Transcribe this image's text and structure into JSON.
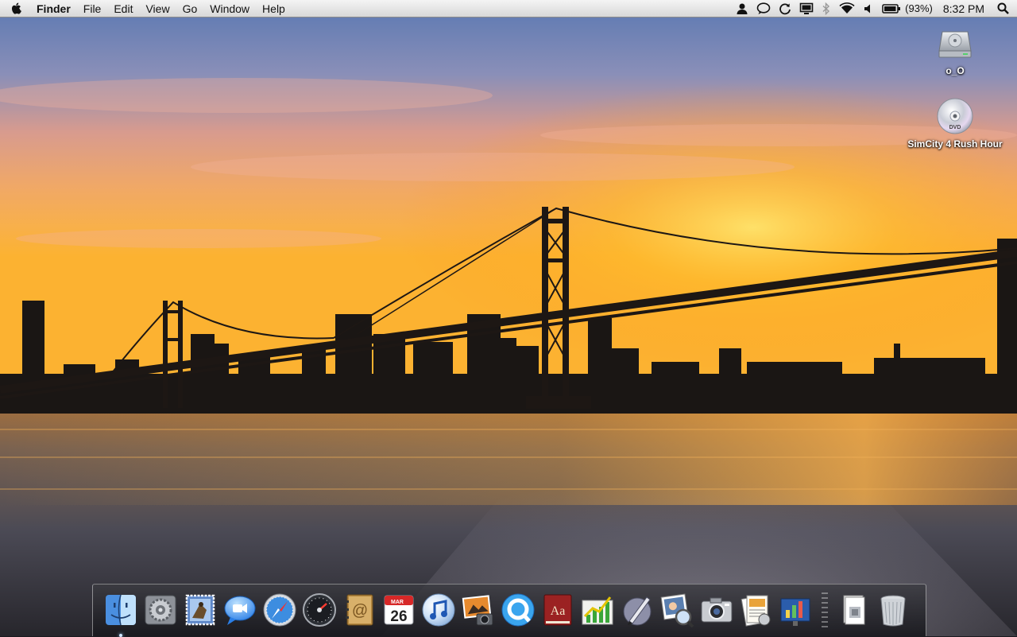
{
  "menubar": {
    "app_name": "Finder",
    "menus": [
      "File",
      "Edit",
      "View",
      "Go",
      "Window",
      "Help"
    ],
    "battery_percent": "(93%)",
    "clock": "8:32 PM",
    "status_icons": [
      "user-icon",
      "ichat-icon",
      "time-machine-icon",
      "display-icon",
      "bluetooth-icon",
      "wifi-icon",
      "volume-icon",
      "battery-icon",
      "spotlight-icon"
    ]
  },
  "desktop": {
    "icons": [
      {
        "label": "o_O",
        "icon": "hard-drive-icon"
      },
      {
        "label": "SimCity 4 Rush Hour",
        "icon": "dvd-icon"
      }
    ]
  },
  "dock": {
    "apps": [
      {
        "icon": "finder-icon",
        "running": true
      },
      {
        "icon": "system-preferences-icon",
        "running": false
      },
      {
        "icon": "mail-icon",
        "running": false
      },
      {
        "icon": "ichat-icon",
        "running": false
      },
      {
        "icon": "safari-icon",
        "running": false
      },
      {
        "icon": "dashboard-icon",
        "running": false
      },
      {
        "icon": "address-book-icon",
        "running": false
      },
      {
        "icon": "ical-icon",
        "running": false,
        "month": "MAR",
        "day": "26"
      },
      {
        "icon": "itunes-icon",
        "running": false
      },
      {
        "icon": "iphoto-icon",
        "running": false
      },
      {
        "icon": "quicktime-icon",
        "running": false
      },
      {
        "icon": "dictionary-icon",
        "running": false,
        "text": "Aa"
      },
      {
        "icon": "numbers-icon",
        "running": false
      },
      {
        "icon": "script-editor-icon",
        "running": false
      },
      {
        "icon": "preview-icon",
        "running": false
      },
      {
        "icon": "image-capture-icon",
        "running": false
      },
      {
        "icon": "pages-icon",
        "running": false
      },
      {
        "icon": "keynote-icon",
        "running": false
      }
    ],
    "others": [
      {
        "icon": "documents-stack-icon"
      },
      {
        "icon": "trash-icon"
      }
    ]
  },
  "colors": {
    "sky_top": "#5f7fb6",
    "sky_mid": "#e39a72",
    "sunset": "#ffb12a",
    "water": "#4a4650",
    "dock_bg": "#2a2a30"
  }
}
